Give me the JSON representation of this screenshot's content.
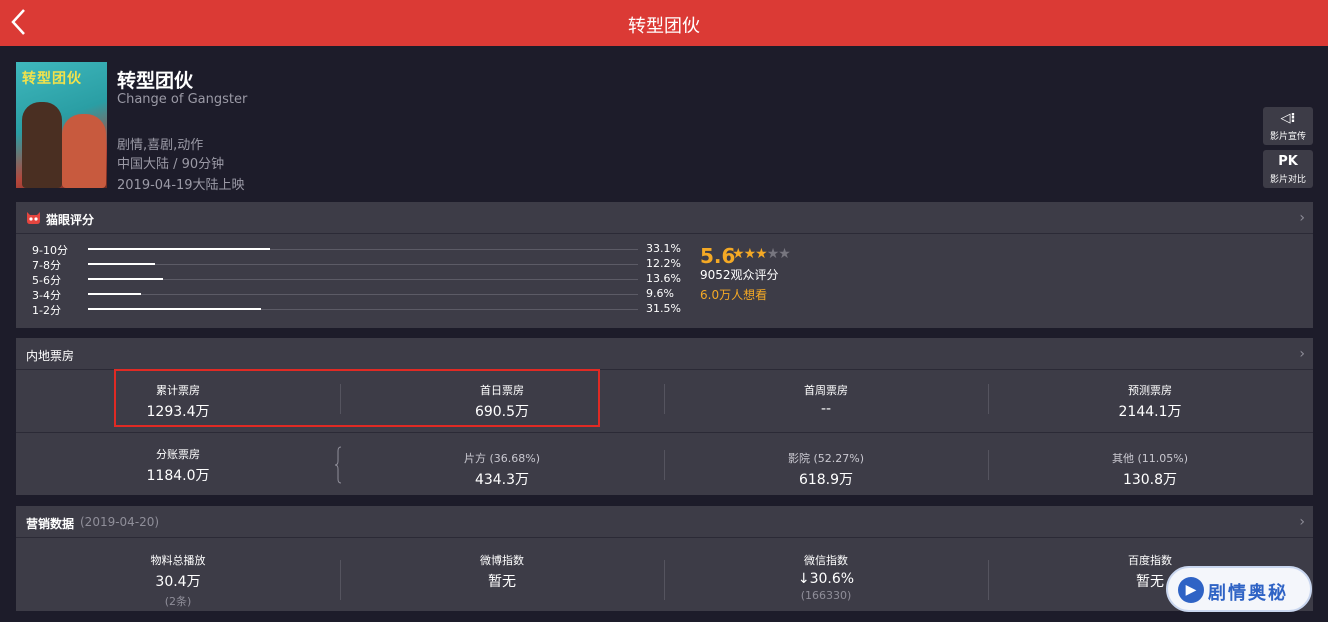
{
  "topbar": {
    "title": "转型团伙"
  },
  "movie": {
    "poster_text": "转型团伙",
    "title": "转型团伙",
    "title_en": "Change of Gangster",
    "genres": "剧情,喜剧,动作",
    "region_duration": "中国大陆 / 90分钟",
    "release": "2019-04-19大陆上映"
  },
  "side_buttons": [
    {
      "icon": "◁⁝",
      "label": "影片宣传",
      "icon_name": "speaker-icon"
    },
    {
      "icon": "PK",
      "label": "影片对比",
      "icon_name": "pk-icon"
    }
  ],
  "rating": {
    "header": "猫眼评分",
    "rows": [
      {
        "label": "9-10分",
        "pct": "33.1%",
        "value": 33.1
      },
      {
        "label": "7-8分",
        "pct": "12.2%",
        "value": 12.2
      },
      {
        "label": "5-6分",
        "pct": "13.6%",
        "value": 13.6
      },
      {
        "label": "3-4分",
        "pct": "9.6%",
        "value": 9.6
      },
      {
        "label": "1-2分",
        "pct": "31.5%",
        "value": 31.5
      }
    ],
    "score": "5.6",
    "stars_on": 3,
    "stars_total": 5,
    "count": "9052观众评分",
    "want": "6.0万人想看"
  },
  "boxoffice": {
    "header": "内地票房",
    "row1": [
      {
        "k": "累计票房",
        "v": "1293.4万"
      },
      {
        "k": "首日票房",
        "v": "690.5万"
      },
      {
        "k": "首周票房",
        "v": "--"
      },
      {
        "k": "预测票房",
        "v": "2144.1万"
      }
    ],
    "row2": [
      {
        "k": "分账票房",
        "v": "1184.0万"
      },
      {
        "k": "片方 (36.68%)",
        "v": "434.3万"
      },
      {
        "k": "影院 (52.27%)",
        "v": "618.9万"
      },
      {
        "k": "其他 (11.05%)",
        "v": "130.8万"
      }
    ]
  },
  "marketing": {
    "header": "营销数据",
    "date": "(2019-04-20)",
    "cells": [
      {
        "k": "物料总播放",
        "v": "30.4万",
        "s": "(2条)"
      },
      {
        "k": "微博指数",
        "v": "暂无",
        "s": ""
      },
      {
        "k": "微信指数",
        "v": "↓30.6%",
        "s": "(166330)"
      },
      {
        "k": "百度指数",
        "v": "暂无",
        "s": ""
      }
    ]
  },
  "watermark": {
    "text": "剧情奥秘"
  },
  "colors": {
    "topbar": "#db3a35",
    "accent": "#f4a925",
    "card": "#3d3c47",
    "background": "#1d1c2a"
  }
}
